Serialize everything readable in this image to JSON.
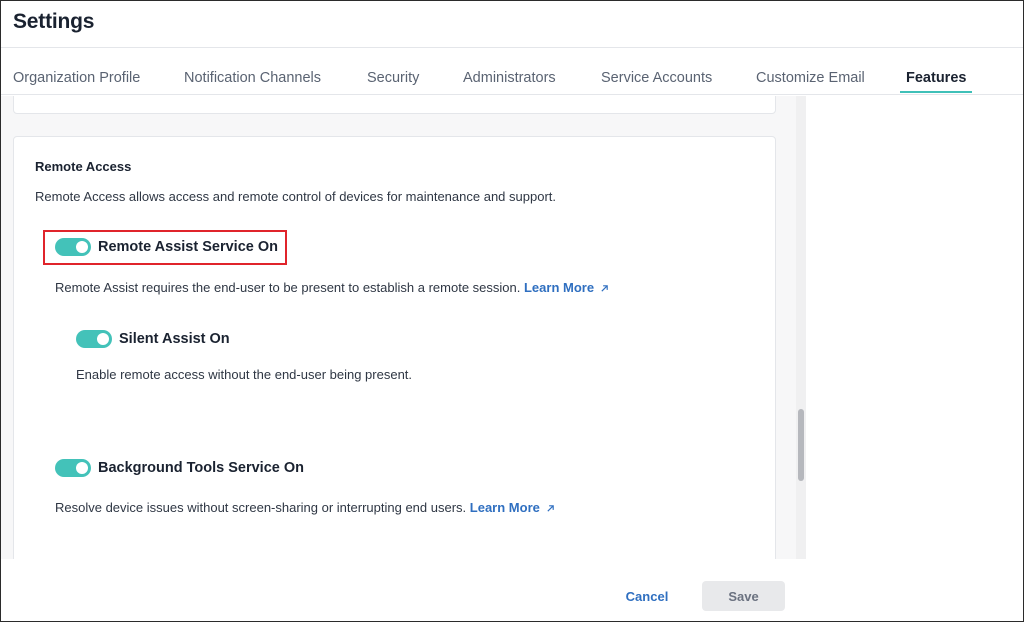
{
  "header": {
    "title": "Settings"
  },
  "tabs": [
    {
      "label": "Organization Profile"
    },
    {
      "label": "Notification Channels"
    },
    {
      "label": "Security"
    },
    {
      "label": "Administrators"
    },
    {
      "label": "Service Accounts"
    },
    {
      "label": "Customize Email"
    },
    {
      "label": "Features",
      "active": true
    }
  ],
  "remote_access": {
    "title": "Remote Access",
    "description": "Remote Access allows access and remote control of devices for maintenance and support.",
    "remote_assist": {
      "label": "Remote Assist Service On",
      "enabled": true,
      "description": "Remote Assist requires the end-user to be present to establish a remote session.",
      "link": "Learn More"
    },
    "silent_assist": {
      "label": "Silent Assist On",
      "enabled": true,
      "description": "Enable remote access without the end-user being present."
    },
    "background_tools": {
      "label": "Background Tools Service On",
      "enabled": true,
      "description": "Resolve device issues without screen-sharing or interrupting end users.",
      "link": "Learn More"
    }
  },
  "footer": {
    "cancel_label": "Cancel",
    "save_label": "Save"
  },
  "colors": {
    "accent": "#43c2b9",
    "link": "#2f6fc0",
    "highlight": "#e0242b"
  },
  "icons": {
    "external_link": "external-link-icon"
  }
}
